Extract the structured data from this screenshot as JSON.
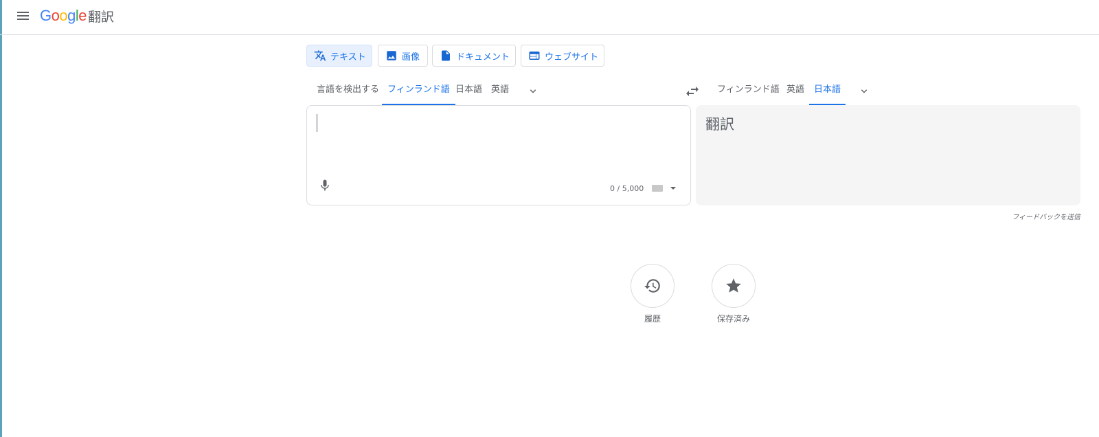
{
  "header": {
    "logo_letters": [
      "G",
      "o",
      "o",
      "g",
      "l",
      "e"
    ],
    "product_name": "翻訳"
  },
  "mode_tabs": [
    {
      "label": "テキスト",
      "icon": "translate-icon",
      "active": true
    },
    {
      "label": "画像",
      "icon": "image-icon",
      "active": false
    },
    {
      "label": "ドキュメント",
      "icon": "document-icon",
      "active": false
    },
    {
      "label": "ウェブサイト",
      "icon": "website-icon",
      "active": false
    }
  ],
  "source_languages": [
    {
      "label": "言語を検出する",
      "active": false
    },
    {
      "label": "フィンランド語",
      "active": true
    },
    {
      "label": "日本語",
      "active": false
    },
    {
      "label": "英語",
      "active": false
    }
  ],
  "target_languages": [
    {
      "label": "フィンランド語",
      "active": false
    },
    {
      "label": "英語",
      "active": false
    },
    {
      "label": "日本語",
      "active": true
    }
  ],
  "source": {
    "value": "",
    "char_count": "0 / 5,000"
  },
  "target": {
    "placeholder_text": "翻訳"
  },
  "feedback_label": "フィードバックを送信",
  "bottom_buttons": [
    {
      "label": "履歴",
      "icon": "history-icon"
    },
    {
      "label": "保存済み",
      "icon": "star-icon"
    }
  ],
  "colors": {
    "accent": "#1a73e8",
    "active_tab_bg": "#e8f0fe",
    "output_bg": "#f5f5f5"
  }
}
